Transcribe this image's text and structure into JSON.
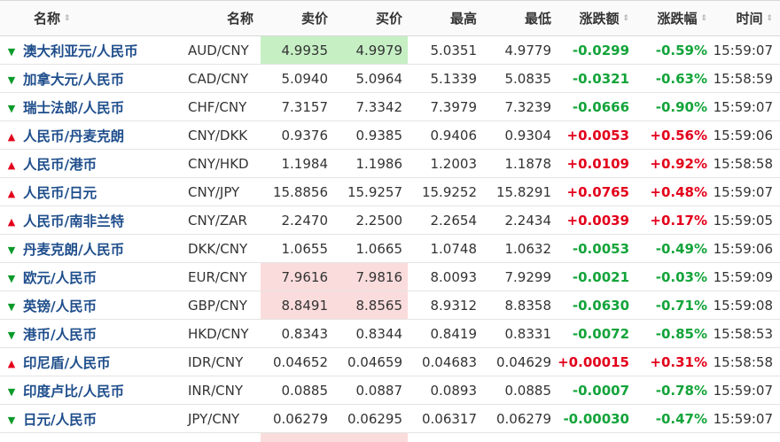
{
  "header": {
    "name_col": "名称",
    "code_col": "名称",
    "sell_col": "卖价",
    "buy_col": "买价",
    "high_col": "最高",
    "low_col": "最低",
    "change_col": "涨跌额",
    "pct_col": "涨跌幅",
    "time_col": "时间",
    "sort_glyph": "⇕"
  },
  "colors": {
    "up": "#e3001b",
    "down": "#0a9a2a",
    "link": "#1f4e8c",
    "highlight_green": "#c6efc4",
    "highlight_red": "#fbdcdc"
  },
  "rows": [
    {
      "dir": "down",
      "arrow": "🡇",
      "name": "澳大利亚元/人民币",
      "code": "AUD/CNY",
      "sell": "4.9935",
      "buy": "4.9979",
      "high": "5.0351",
      "low": "4.9779",
      "change": "-0.0299",
      "pct": "-0.59%",
      "time": "15:59:07",
      "hl": "green"
    },
    {
      "dir": "down",
      "arrow": "🡇",
      "name": "加拿大元/人民币",
      "code": "CAD/CNY",
      "sell": "5.0940",
      "buy": "5.0964",
      "high": "5.1339",
      "low": "5.0835",
      "change": "-0.0321",
      "pct": "-0.63%",
      "time": "15:58:59",
      "hl": ""
    },
    {
      "dir": "down",
      "arrow": "🡇",
      "name": "瑞士法郎/人民币",
      "code": "CHF/CNY",
      "sell": "7.3157",
      "buy": "7.3342",
      "high": "7.3979",
      "low": "7.3239",
      "change": "-0.0666",
      "pct": "-0.90%",
      "time": "15:59:07",
      "hl": ""
    },
    {
      "dir": "up",
      "arrow": "🡅",
      "name": "人民币/丹麦克朗",
      "code": "CNY/DKK",
      "sell": "0.9376",
      "buy": "0.9385",
      "high": "0.9406",
      "low": "0.9304",
      "change": "+0.0053",
      "pct": "+0.56%",
      "time": "15:59:06",
      "hl": ""
    },
    {
      "dir": "up",
      "arrow": "🡅",
      "name": "人民币/港币",
      "code": "CNY/HKD",
      "sell": "1.1984",
      "buy": "1.1986",
      "high": "1.2003",
      "low": "1.1878",
      "change": "+0.0109",
      "pct": "+0.92%",
      "time": "15:58:58",
      "hl": ""
    },
    {
      "dir": "up",
      "arrow": "🡅",
      "name": "人民币/日元",
      "code": "CNY/JPY",
      "sell": "15.8856",
      "buy": "15.9257",
      "high": "15.9252",
      "low": "15.8291",
      "change": "+0.0765",
      "pct": "+0.48%",
      "time": "15:59:07",
      "hl": ""
    },
    {
      "dir": "up",
      "arrow": "🡅",
      "name": "人民币/南非兰特",
      "code": "CNY/ZAR",
      "sell": "2.2470",
      "buy": "2.2500",
      "high": "2.2654",
      "low": "2.2434",
      "change": "+0.0039",
      "pct": "+0.17%",
      "time": "15:59:05",
      "hl": ""
    },
    {
      "dir": "down",
      "arrow": "🡇",
      "name": "丹麦克朗/人民币",
      "code": "DKK/CNY",
      "sell": "1.0655",
      "buy": "1.0665",
      "high": "1.0748",
      "low": "1.0632",
      "change": "-0.0053",
      "pct": "-0.49%",
      "time": "15:59:06",
      "hl": ""
    },
    {
      "dir": "down",
      "arrow": "🡇",
      "name": "欧元/人民币",
      "code": "EUR/CNY",
      "sell": "7.9616",
      "buy": "7.9816",
      "high": "8.0093",
      "low": "7.9299",
      "change": "-0.0021",
      "pct": "-0.03%",
      "time": "15:59:09",
      "hl": "red"
    },
    {
      "dir": "down",
      "arrow": "🡇",
      "name": "英镑/人民币",
      "code": "GBP/CNY",
      "sell": "8.8491",
      "buy": "8.8565",
      "high": "8.9312",
      "low": "8.8358",
      "change": "-0.0630",
      "pct": "-0.71%",
      "time": "15:59:08",
      "hl": "red"
    },
    {
      "dir": "down",
      "arrow": "🡇",
      "name": "港币/人民币",
      "code": "HKD/CNY",
      "sell": "0.8343",
      "buy": "0.8344",
      "high": "0.8419",
      "low": "0.8331",
      "change": "-0.0072",
      "pct": "-0.85%",
      "time": "15:58:53",
      "hl": ""
    },
    {
      "dir": "up",
      "arrow": "🡅",
      "name": "印尼盾/人民币",
      "code": "IDR/CNY",
      "sell": "0.04652",
      "buy": "0.04659",
      "high": "0.04683",
      "low": "0.04629",
      "change": "+0.00015",
      "pct": "+0.31%",
      "time": "15:58:58",
      "hl": ""
    },
    {
      "dir": "down",
      "arrow": "🡇",
      "name": "印度卢比/人民币",
      "code": "INR/CNY",
      "sell": "0.0885",
      "buy": "0.0887",
      "high": "0.0893",
      "low": "0.0885",
      "change": "-0.0007",
      "pct": "-0.78%",
      "time": "15:59:07",
      "hl": ""
    },
    {
      "dir": "down",
      "arrow": "🡇",
      "name": "日元/人民币",
      "code": "JPY/CNY",
      "sell": "0.06279",
      "buy": "0.06295",
      "high": "0.06317",
      "low": "0.06279",
      "change": "-0.00030",
      "pct": "-0.47%",
      "time": "15:59:07",
      "hl": ""
    }
  ]
}
